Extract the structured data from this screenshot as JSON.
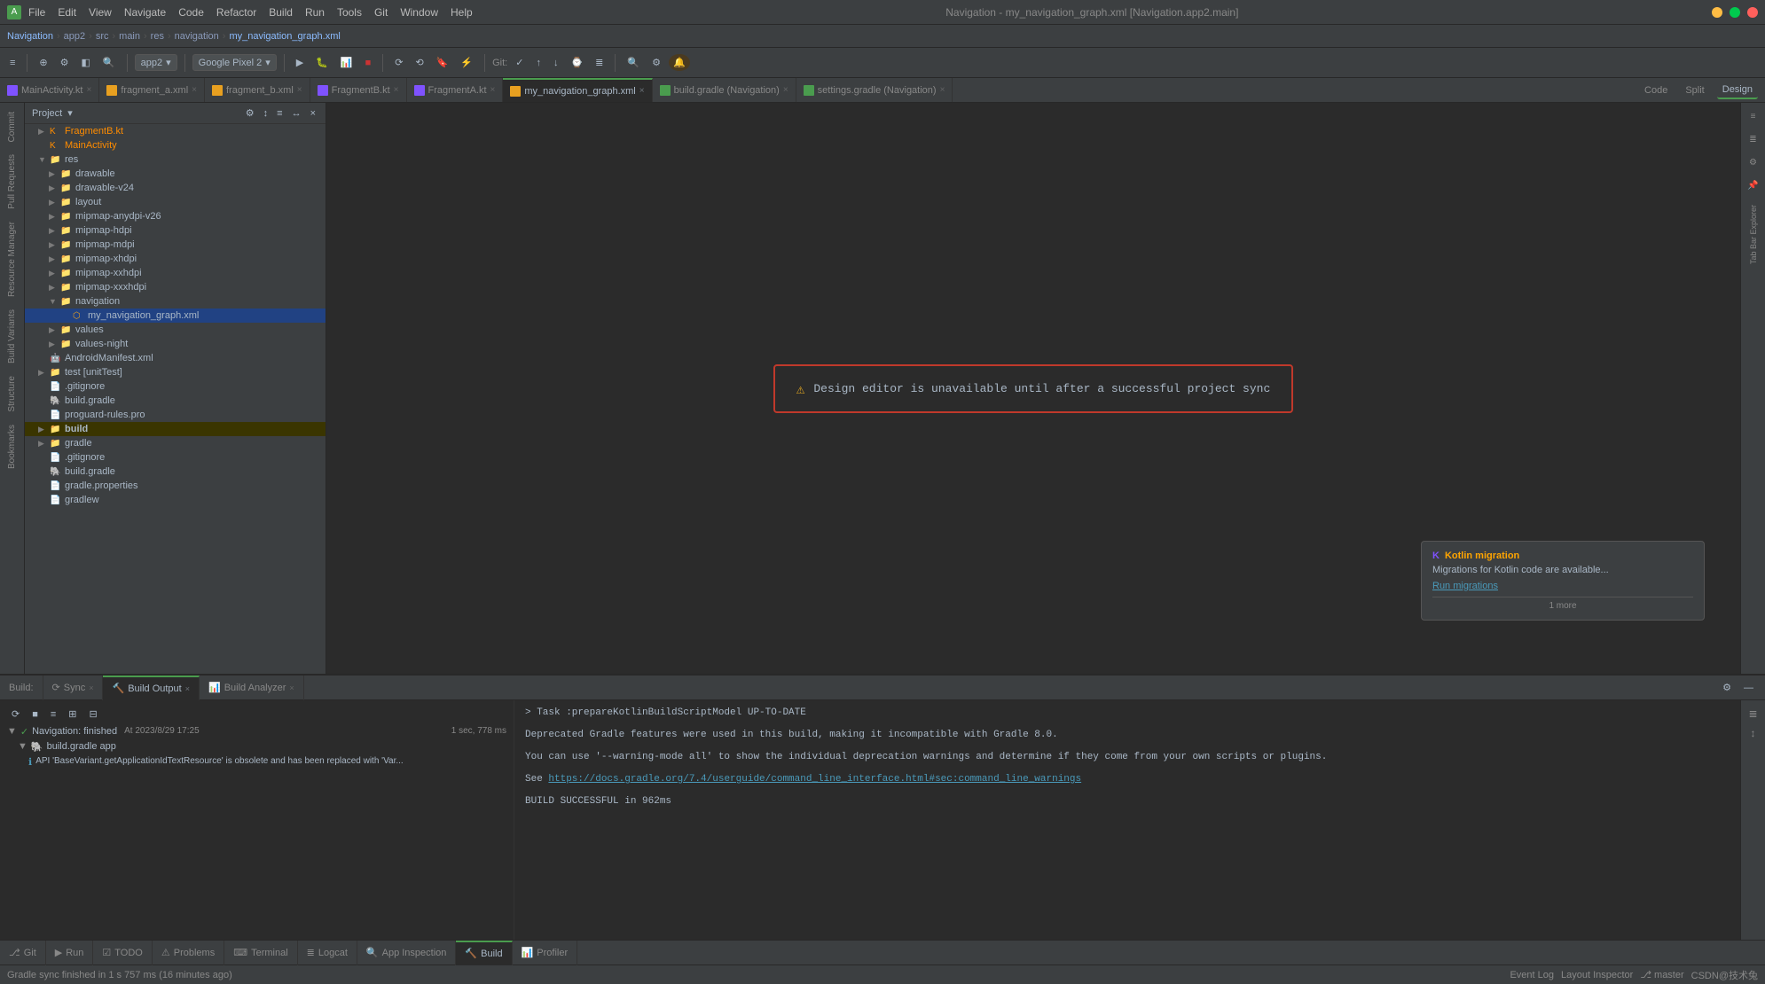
{
  "titleBar": {
    "icon": "A",
    "menus": [
      "File",
      "Edit",
      "View",
      "Navigate",
      "Code",
      "Refactor",
      "Build",
      "Run",
      "Tools",
      "Git",
      "Window",
      "Help"
    ],
    "title": "Navigation - my_navigation_graph.xml [Navigation.app2.main]",
    "controls": [
      "minimize",
      "maximize",
      "close"
    ]
  },
  "navBar": {
    "parts": [
      "Navigation",
      "app2",
      "src",
      "main",
      "res",
      "navigation",
      "my_navigation_graph.xml"
    ]
  },
  "tabs": [
    {
      "label": "MainActivity.kt",
      "type": "kt",
      "active": false,
      "closable": true
    },
    {
      "label": "fragment_a.xml",
      "type": "xml",
      "active": false,
      "closable": true
    },
    {
      "label": "fragment_b.xml",
      "type": "xml",
      "active": false,
      "closable": true
    },
    {
      "label": "FragmentB.kt",
      "type": "kt",
      "active": false,
      "closable": true
    },
    {
      "label": "FragmentA.kt",
      "type": "kt",
      "active": false,
      "closable": true
    },
    {
      "label": "my_navigation_graph.xml",
      "type": "xml",
      "active": true,
      "closable": true
    },
    {
      "label": "build.gradle (Navigation)",
      "type": "gradle",
      "active": false,
      "closable": true
    },
    {
      "label": "settings.gradle (Navigation)",
      "type": "gradle",
      "active": false,
      "closable": true
    }
  ],
  "rightTabs": [
    "Code",
    "Split",
    "Design"
  ],
  "activeRightTab": "Design",
  "sidebar": {
    "header": "Project",
    "items": [
      {
        "indent": 0,
        "arrow": "▶",
        "icon": "📁",
        "label": "FragmentB.kt",
        "type": "kt",
        "selected": false
      },
      {
        "indent": 0,
        "arrow": "",
        "icon": "📄",
        "label": "MainActivity",
        "type": "kt",
        "selected": false
      },
      {
        "indent": 0,
        "arrow": "▶",
        "icon": "📁",
        "label": "res",
        "type": "folder",
        "selected": false
      },
      {
        "indent": 1,
        "arrow": "▶",
        "icon": "📁",
        "label": "drawable",
        "type": "folder",
        "selected": false
      },
      {
        "indent": 1,
        "arrow": "▶",
        "icon": "📁",
        "label": "drawable-v24",
        "type": "folder",
        "selected": false
      },
      {
        "indent": 1,
        "arrow": "▶",
        "icon": "📁",
        "label": "layout",
        "type": "folder",
        "selected": false
      },
      {
        "indent": 1,
        "arrow": "▶",
        "icon": "📁",
        "label": "mipmap-anydpi-v26",
        "type": "folder",
        "selected": false
      },
      {
        "indent": 1,
        "arrow": "▶",
        "icon": "📁",
        "label": "mipmap-hdpi",
        "type": "folder",
        "selected": false
      },
      {
        "indent": 1,
        "arrow": "▶",
        "icon": "📁",
        "label": "mipmap-mdpi",
        "type": "folder",
        "selected": false
      },
      {
        "indent": 1,
        "arrow": "▶",
        "icon": "📁",
        "label": "mipmap-xhdpi",
        "type": "folder",
        "selected": false
      },
      {
        "indent": 1,
        "arrow": "▶",
        "icon": "📁",
        "label": "mipmap-xxhdpi",
        "type": "folder",
        "selected": false
      },
      {
        "indent": 1,
        "arrow": "▶",
        "icon": "📁",
        "label": "mipmap-xxxhdpi",
        "type": "folder",
        "selected": false
      },
      {
        "indent": 1,
        "arrow": "▼",
        "icon": "📁",
        "label": "navigation",
        "type": "folder",
        "selected": false
      },
      {
        "indent": 2,
        "arrow": "",
        "icon": "🗺",
        "label": "my_navigation_graph.xml",
        "type": "xml",
        "selected": true
      },
      {
        "indent": 1,
        "arrow": "▶",
        "icon": "📁",
        "label": "values",
        "type": "folder",
        "selected": false
      },
      {
        "indent": 1,
        "arrow": "▶",
        "icon": "📁",
        "label": "values-night",
        "type": "folder",
        "selected": false
      },
      {
        "indent": 0,
        "arrow": "",
        "icon": "📄",
        "label": "AndroidManifest.xml",
        "type": "xml",
        "selected": false
      },
      {
        "indent": 0,
        "arrow": "▶",
        "icon": "📁",
        "label": "test [unitTest]",
        "type": "folder",
        "selected": false
      },
      {
        "indent": 0,
        "arrow": "",
        "icon": "📄",
        "label": ".gitignore",
        "type": "",
        "selected": false
      },
      {
        "indent": 0,
        "arrow": "",
        "icon": "🐘",
        "label": "build.gradle",
        "type": "gradle",
        "selected": false
      },
      {
        "indent": 0,
        "arrow": "",
        "icon": "📄",
        "label": "proguard-rules.pro",
        "type": "",
        "selected": false
      },
      {
        "indent": 0,
        "arrow": "▶",
        "icon": "📁",
        "label": "build",
        "type": "folder",
        "selected": false,
        "highlighted": true
      },
      {
        "indent": 0,
        "arrow": "▶",
        "icon": "📁",
        "label": "gradle",
        "type": "folder",
        "selected": false
      },
      {
        "indent": 0,
        "arrow": "",
        "icon": "📄",
        "label": ".gitignore",
        "type": "",
        "selected": false
      },
      {
        "indent": 0,
        "arrow": "",
        "icon": "🐘",
        "label": "build.gradle",
        "type": "gradle",
        "selected": false
      },
      {
        "indent": 0,
        "arrow": "",
        "icon": "📄",
        "label": "gradle.properties",
        "type": "",
        "selected": false
      },
      {
        "indent": 0,
        "arrow": "",
        "icon": "📄",
        "label": "gradlew",
        "type": "",
        "selected": false
      }
    ]
  },
  "editor": {
    "message": "Design editor is unavailable until after a successful project sync"
  },
  "bottomPanel": {
    "tabs": [
      {
        "label": "Build:",
        "active": false
      },
      {
        "label": "Sync",
        "active": false,
        "closable": true
      },
      {
        "label": "Build Output",
        "active": true,
        "closable": true
      },
      {
        "label": "Build Analyzer",
        "active": false,
        "closable": true
      }
    ],
    "buildTree": {
      "items": [
        {
          "indent": 0,
          "check": "✓",
          "label": "Navigation: finished",
          "time": "At 2023/8/29 17:25",
          "duration": "1 sec, 778 ms"
        },
        {
          "indent": 1,
          "check": "",
          "icon": "🐘",
          "label": "build.gradle app"
        },
        {
          "indent": 2,
          "check": "",
          "icon": "ℹ",
          "label": "API 'BaseVariant.getApplicationIdTextResource' is obsolete and has been replaced with 'Var..."
        }
      ]
    },
    "buildOutput": {
      "lines": [
        "> Task :prepareKotlinBuildScriptModel UP-TO-DATE",
        "",
        "Deprecated Gradle features were used in this build, making it incompatible with Gradle 8.0.",
        "",
        "You can use '--warning-mode all' to show the individual deprecation warnings and determine if they come from your own scripts or plugins.",
        "",
        "See https://docs.gradle.org/7.4/userguide/command_line_interface.html#sec:command_line_warnings",
        "",
        "BUILD SUCCESSFUL in 962ms"
      ],
      "link": "https://docs.gradle.org/7.4/userguide/command_line_interface.html#sec:command_line_warnings",
      "linkText": "https://docs.gradle.org/7.4/userguide/command_line_interface.html#sec:command_line_warnings"
    }
  },
  "footerTabs": [
    {
      "label": "Git",
      "active": false,
      "icon": "⎇"
    },
    {
      "label": "Run",
      "active": false,
      "icon": "▶"
    },
    {
      "label": "TODO",
      "active": false,
      "icon": "☑"
    },
    {
      "label": "Problems",
      "active": false,
      "icon": "⚠"
    },
    {
      "label": "Terminal",
      "active": false,
      "icon": "⌨"
    },
    {
      "label": "Logcat",
      "active": false,
      "icon": "📋"
    },
    {
      "label": "App Inspection",
      "active": false,
      "icon": "🔍"
    },
    {
      "label": "Build",
      "active": true,
      "icon": "🔨"
    },
    {
      "label": "Profiler",
      "active": false,
      "icon": "📊"
    }
  ],
  "statusBar": {
    "message": "Gradle sync finished in 1 s 757 ms (16 minutes ago)",
    "branch": "master",
    "rightItems": [
      "Event Log",
      "Layout Inspector",
      "CSDN@技术兔"
    ]
  },
  "notification": {
    "title": "Kotlin migration",
    "body": "Migrations for Kotlin code are available...",
    "link": "Run migrations",
    "more": "1 more"
  },
  "leftStrip": {
    "items": [
      "Commit",
      "Pull Requests",
      "Resource Manager",
      "Build Variants",
      "Structure",
      "Bookmarks"
    ]
  },
  "toolbar": {
    "app2Label": "app2",
    "deviceLabel": "Google Pixel 2",
    "gitLabel": "Git:"
  }
}
